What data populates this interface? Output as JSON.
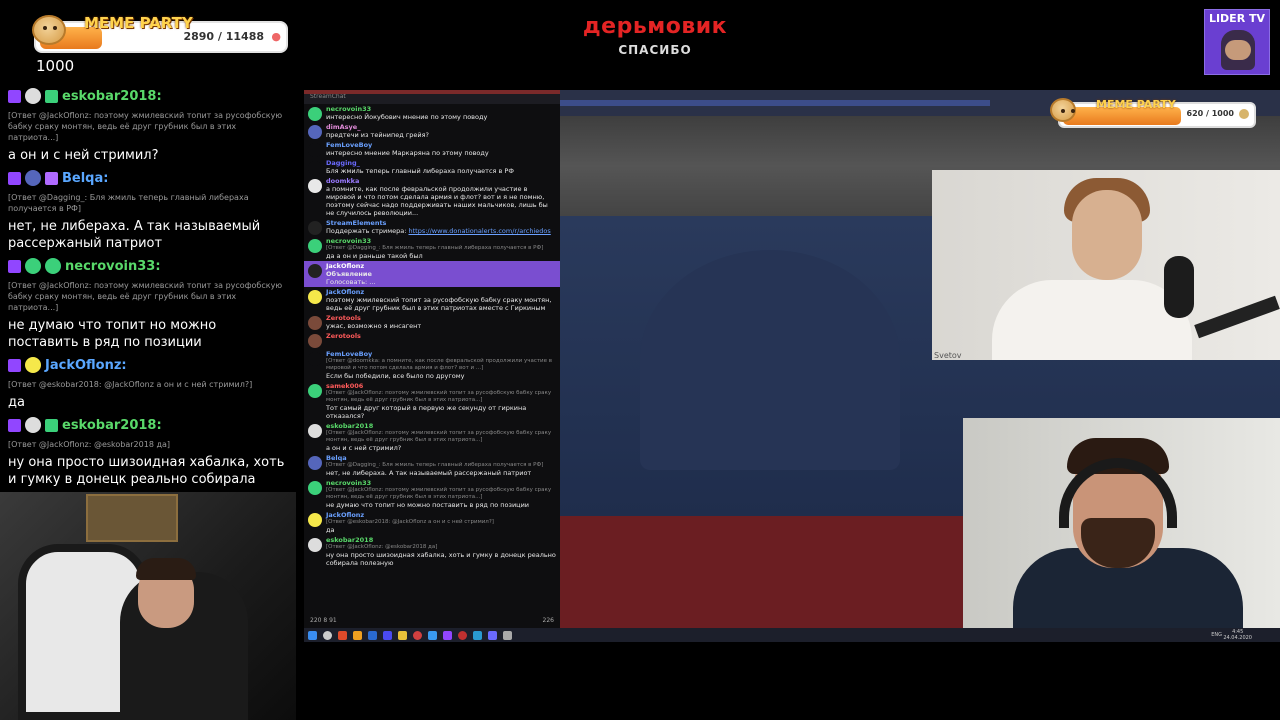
{
  "overlay": {
    "meme_party_title": "MEME PARTY",
    "meme_party_count": "2890 / 11488",
    "meme_party_progress": 0.25,
    "counter": "1000",
    "main_title": "дерьмовик",
    "main_subtitle": "СПАСИБО",
    "channel_badge": "LIDER TV"
  },
  "left_chat": [
    {
      "type": "head",
      "user": "eskobar2018:",
      "color": "#59d96a",
      "badges": [
        "twitch",
        "avatar-skull",
        "green-check"
      ]
    },
    {
      "type": "reply",
      "text": "[Ответ @JackOflonz: поэтому жмилевский топит за русофобскую бабку сраку монтян, ведь её друг грубник был в этих патриота...]"
    },
    {
      "type": "text",
      "text": "а он и с ней стримил?"
    },
    {
      "type": "head",
      "user": "Belqa:",
      "color": "#5aa7ff",
      "badges": [
        "twitch",
        "avatar-blue",
        "purple-box"
      ]
    },
    {
      "type": "reply",
      "text": "[Ответ @Dagging_: Бля жмиль теперь главный либераха получается в РФ]"
    },
    {
      "type": "text",
      "text": "нет, не либераха. А так называемый рассержаный патриот"
    },
    {
      "type": "head",
      "user": "necrovoin33:",
      "color": "#59d96a",
      "badges": [
        "twitch",
        "avatar-green",
        "green-circle"
      ]
    },
    {
      "type": "reply",
      "text": "[Ответ @JackOflonz: поэтому жмилевский топит за русофобскую бабку сраку монтян, ведь её друг грубник был в этих патриота...]"
    },
    {
      "type": "text",
      "text": "не думаю что топит но можно поставить в ряд по позиции"
    },
    {
      "type": "head",
      "user": "JackOflonz:",
      "color": "#5aa7ff",
      "badges": [
        "twitch",
        "avatar-yellow"
      ]
    },
    {
      "type": "reply",
      "text": "[Ответ @eskobar2018: @JackOflonz а он и с ней стримил?]"
    },
    {
      "type": "text",
      "text": "да"
    },
    {
      "type": "head",
      "user": "eskobar2018:",
      "color": "#59d96a",
      "badges": [
        "twitch",
        "avatar-skull",
        "green-check"
      ]
    },
    {
      "type": "reply",
      "text": "[Ответ @JackOflonz: @eskobar2018 да]"
    },
    {
      "type": "text",
      "text": "ну она просто шизоидная хабалка, хоть и гумку в донецк реально собирала полезную"
    }
  ],
  "screen": {
    "chat_window_title": "StreamChat",
    "meme_party_title": "MEME PARTY",
    "meme_party_count": "620 / 1000",
    "meme_party_progress": 0.62,
    "guest1_label": "Svetov",
    "chat_footer": "220  8  91",
    "chat_footer_viewers": "226",
    "chat": [
      {
        "user": "necrovoin33",
        "color": "#59d96a",
        "av": "#3bd07a",
        "text": "интересно Йокубович мнение по этому поводу"
      },
      {
        "user": "dimAsye_",
        "color": "#e08bd8",
        "av": "#5566bb",
        "text": "предтечи из тейнипед грейя?"
      },
      {
        "user": "FemLoveBoy",
        "color": "#6aa0ff",
        "av": "#0e0e10",
        "text": "интересно мнение Маркаряна по этому поводу"
      },
      {
        "user": "Dagging_",
        "color": "#6a6aff",
        "av": "#0e0e10",
        "text": "Бля жмиль теперь главный либераха получается в РФ"
      },
      {
        "user": "doomkka",
        "color": "#9a7aff",
        "av": "#e8e8e8",
        "text": "а помните, как после февральской продолжили участие в мировой и что потом сделала армия и флот? вот и я не помню, поэтому сейчас надо поддерживать наших мальчиков, лишь бы не случилось революции..."
      },
      {
        "user": "StreamElements",
        "color": "#6aa0ff",
        "av": "#222",
        "text": "Поддержать стримера:",
        "link": "https://www.donationalerts.com/r/archiedos"
      },
      {
        "user": "necrovoin33",
        "color": "#59d96a",
        "av": "#3bd07a",
        "reply": "[Ответ @Dagging_: Бля жмиль теперь главный либераха получается в РФ]",
        "text": "да а он и раньше такой был"
      },
      {
        "user": "JackOflonz",
        "color": "#fff",
        "av": "#222",
        "announce": true,
        "label": "Объявление",
        "text": "Голосовать: ..."
      },
      {
        "user": "JackOflonz",
        "color": "#6aa0ff",
        "av": "#f5e84a",
        "text": "поэтому жмилевский топит за русофобскую бабку сраку монтян, ведь её друг грубник был в этих патриотах вместе с Гиркиным"
      },
      {
        "user": "Zerotools",
        "color": "#ff5a5a",
        "av": "#7a4a3a",
        "text": "ужас, возможно я инсагент"
      },
      {
        "user": "Zerotools",
        "color": "#ff5a5a",
        "av": "#7a4a3a",
        "text": ""
      },
      {
        "user": "FemLoveBoy",
        "color": "#6aa0ff",
        "av": "#0e0e10",
        "reply": "[Ответ @doomkka: а помните, как после февральской продолжили участие в мировой и что потом сделала армия и флот? вот и ...]",
        "text": "Если бы победили, все было по другому"
      },
      {
        "user": "samek006",
        "color": "#ff5a5a",
        "av": "#3bd07a",
        "reply": "[Ответ @JackOflonz: поэтому жмилевский топит за русофобскую бабку сраку монтян, ведь её друг грубник был в этих патриота...]",
        "text": "Тот самый друг который в первую же секунду от гиркина отказался?"
      },
      {
        "user": "eskobar2018",
        "color": "#59d96a",
        "av": "#ddd",
        "reply": "[Ответ @JackOflonz: поэтому жмилевский топит за русофобскую бабку сраку монтян, ведь её друг грубник был в этих патриота...]",
        "text": "а он и с ней стримил?"
      },
      {
        "user": "Belqa",
        "color": "#6aa0ff",
        "av": "#5566bb",
        "reply": "[Ответ @Dagging_: Бля жмиль теперь главный либераха получается в РФ]",
        "text": "нет, не либераха. А так называемый рассержаный патриот"
      },
      {
        "user": "necrovoin33",
        "color": "#59d96a",
        "av": "#3bd07a",
        "reply": "[Ответ @JackOflonz: поэтому жмилевский топит за русофобскую бабку сраку монтян, ведь её друг грубник был в этих патриота...]",
        "text": "не думаю что топит но можно поставить в ряд по позиции"
      },
      {
        "user": "JackOflonz",
        "color": "#6aa0ff",
        "av": "#f5e84a",
        "reply": "[Ответ @eskobar2018: @JackOflonz а он и с ней стримил?]",
        "text": "да"
      },
      {
        "user": "eskobar2018",
        "color": "#59d96a",
        "av": "#ddd",
        "reply": "[Ответ @JackOflonz: @eskobar2018 да]",
        "text": "ну она просто шизоидная хабалка, хоть и гумку в донецк реально собирала полезную"
      }
    ],
    "tray_lang": "ENG",
    "tray_time": "4:45",
    "tray_date": "24.04.2020"
  }
}
